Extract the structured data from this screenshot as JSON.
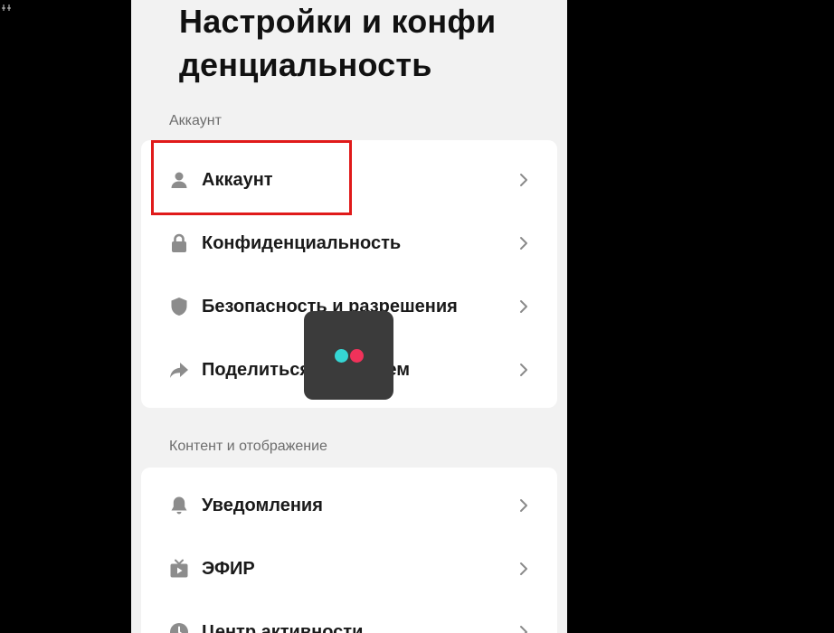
{
  "header": {
    "title_line1": "Настройки и конфи",
    "title_line2": "денциальность"
  },
  "sections": {
    "account": {
      "header": "Аккаунт",
      "items": [
        {
          "label": "Аккаунт",
          "icon": "person-icon"
        },
        {
          "label": "Конфиденциальность",
          "icon": "lock-icon"
        },
        {
          "label": "Безопасность и разрешения",
          "icon": "shield-icon"
        },
        {
          "label": "Поделиться профилем",
          "icon": "share-arrow-icon"
        }
      ]
    },
    "content": {
      "header": "Контент и отображение",
      "items": [
        {
          "label": "Уведомления",
          "icon": "bell-icon"
        },
        {
          "label": "ЭФИР",
          "icon": "tv-live-icon"
        },
        {
          "label": "Центр активности",
          "icon": "clock-icon"
        }
      ]
    }
  },
  "colors": {
    "highlight": "#e01a1a",
    "icon": "#8c8c8c",
    "loader_cyan": "#35d6d4",
    "loader_red": "#f0325a"
  }
}
